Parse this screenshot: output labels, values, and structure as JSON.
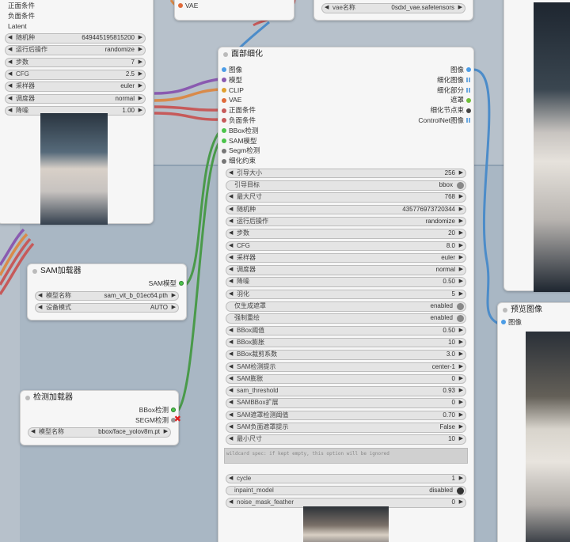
{
  "colors": {
    "canvas": "#b7c1cb",
    "node_bg": "#f6f6f6",
    "wire_blue": "#4c8cc9",
    "wire_green": "#4a9a4a",
    "wire_orange": "#d98a4a",
    "wire_purple": "#8a5ab0",
    "wire_red": "#c65a5a"
  },
  "top_left_node": {
    "outputs": [
      "正面条件",
      "负面条件",
      "Latent"
    ],
    "widgets": [
      {
        "label": "随机种",
        "value": "649445195815200"
      },
      {
        "label": "运行后操作",
        "value": "randomize"
      },
      {
        "label": "步数",
        "value": "7"
      },
      {
        "label": "CFG",
        "value": "2.5"
      },
      {
        "label": "采样器",
        "value": "euler"
      },
      {
        "label": "调度器",
        "value": "normal"
      },
      {
        "label": "降噪",
        "value": "1.00"
      }
    ]
  },
  "vae_input_node": {
    "input": "VAE"
  },
  "vae_loader_node": {
    "label": "vae名称",
    "value": "0sdxl_vae.safetensors"
  },
  "face_detailer": {
    "title": "面部细化",
    "inputs": [
      "图像",
      "模型",
      "CLIP",
      "VAE",
      "正面条件",
      "负面条件",
      "BBox检测",
      "SAM模型",
      "Segm检测",
      "细化约束"
    ],
    "outputs": [
      "图像",
      "细化图像",
      "细化部分",
      "遮罩",
      "细化节点束",
      "ControlNet图像"
    ],
    "widgets": [
      {
        "label": "引导大小",
        "value": "256",
        "kind": "num"
      },
      {
        "label": "引导目标",
        "value": "bbox",
        "kind": "toggle"
      },
      {
        "label": "最大尺寸",
        "value": "768",
        "kind": "num"
      },
      {
        "label": "随机种",
        "value": "435776973720344",
        "kind": "num"
      },
      {
        "label": "运行后操作",
        "value": "randomize",
        "kind": "num"
      },
      {
        "label": "步数",
        "value": "20",
        "kind": "num"
      },
      {
        "label": "CFG",
        "value": "8.0",
        "kind": "num"
      },
      {
        "label": "采样器",
        "value": "euler",
        "kind": "num"
      },
      {
        "label": "调度器",
        "value": "normal",
        "kind": "num"
      },
      {
        "label": "降噪",
        "value": "0.50",
        "kind": "num"
      },
      {
        "label": "羽化",
        "value": "5",
        "kind": "num"
      },
      {
        "label": "仅生成遮罩",
        "value": "enabled",
        "kind": "toggle"
      },
      {
        "label": "强制重绘",
        "value": "enabled",
        "kind": "toggle"
      },
      {
        "label": "BBox阈值",
        "value": "0.50",
        "kind": "num"
      },
      {
        "label": "BBox膨胀",
        "value": "10",
        "kind": "num"
      },
      {
        "label": "BBox裁剪系数",
        "value": "3.0",
        "kind": "num"
      },
      {
        "label": "SAM检测提示",
        "value": "center-1",
        "kind": "num"
      },
      {
        "label": "SAM膨胀",
        "value": "0",
        "kind": "num"
      },
      {
        "label": "sam_threshold",
        "value": "0.93",
        "kind": "num"
      },
      {
        "label": "SAMBBox扩展",
        "value": "0",
        "kind": "num"
      },
      {
        "label": "SAM遮罩检测阈值",
        "value": "0.70",
        "kind": "num"
      },
      {
        "label": "SAM负面遮罩提示",
        "value": "False",
        "kind": "num"
      },
      {
        "label": "最小尺寸",
        "value": "10",
        "kind": "num"
      }
    ],
    "wildcard_text": "wildcard spec: if kept empty, this option will be ignored",
    "widgets2": [
      {
        "label": "cycle",
        "value": "1",
        "kind": "num"
      },
      {
        "label": "inpaint_model",
        "value": "disabled",
        "kind": "toggle_dark"
      },
      {
        "label": "noise_mask_feather",
        "value": "0",
        "kind": "num"
      }
    ]
  },
  "sam_loader": {
    "title": "SAM加载器",
    "output": "SAM模型",
    "widgets": [
      {
        "label": "模型名称",
        "value": "sam_vit_b_01ec64.pth"
      },
      {
        "label": "设备模式",
        "value": "AUTO"
      }
    ]
  },
  "detector_loader": {
    "title": "检测加载器",
    "outputs": [
      "BBox检测",
      "SEGM检测"
    ],
    "widgets": [
      {
        "label": "模型名称",
        "value": "bbox/face_yolov8m.pt"
      }
    ]
  },
  "preview_node": {
    "title": "预览图像",
    "input": "图像"
  }
}
